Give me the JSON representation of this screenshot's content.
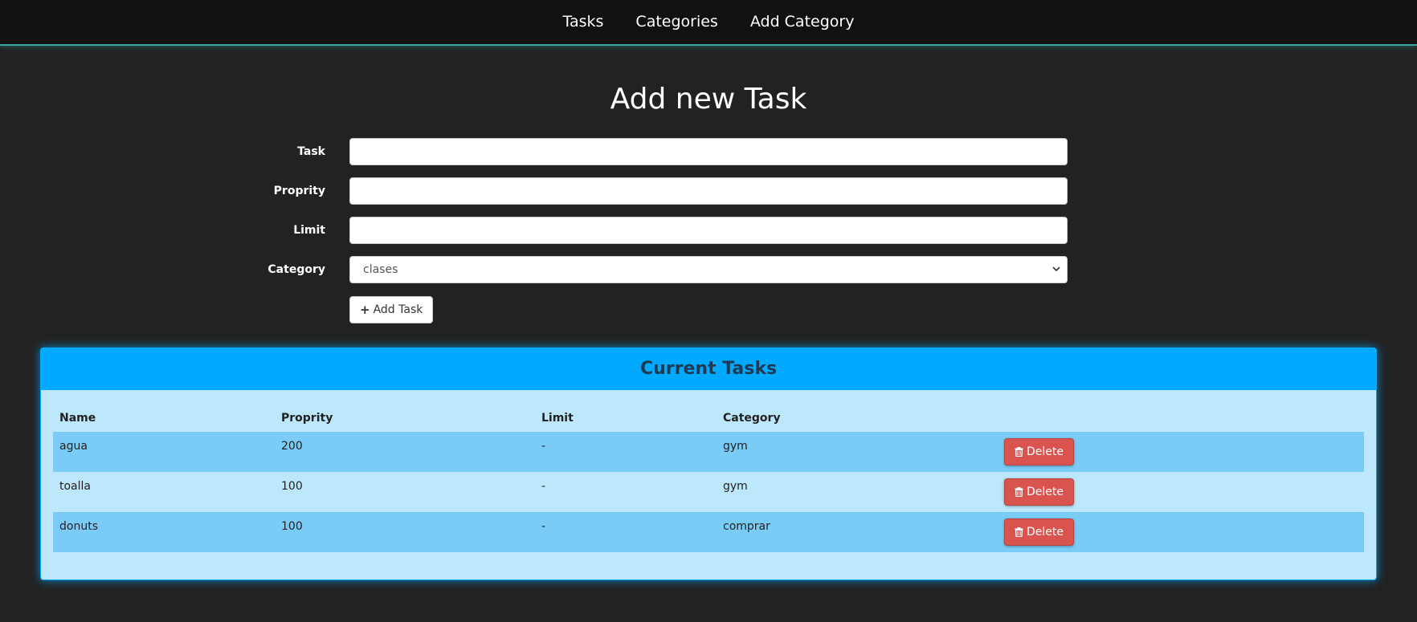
{
  "nav": {
    "items": [
      "Tasks",
      "Categories",
      "Add Category"
    ]
  },
  "page": {
    "title": "Add new Task"
  },
  "form": {
    "task_label": "Task",
    "task_value": "",
    "proprity_label": "Proprity",
    "proprity_value": "",
    "limit_label": "Limit",
    "limit_value": "",
    "category_label": "Category",
    "category_selected": "clases",
    "add_button_label": "Add Task",
    "add_button_icon": "plus-icon"
  },
  "panel": {
    "title": "Current Tasks",
    "columns": [
      "Name",
      "Proprity",
      "Limit",
      "Category"
    ],
    "rows": [
      {
        "name": "agua",
        "proprity": "200",
        "limit": "-",
        "category": "gym",
        "action": "Delete"
      },
      {
        "name": "toalla",
        "proprity": "100",
        "limit": "-",
        "category": "gym",
        "action": "Delete"
      },
      {
        "name": "donuts",
        "proprity": "100",
        "limit": "-",
        "category": "comprar",
        "action": "Delete"
      }
    ],
    "delete_icon": "trash-icon"
  },
  "colors": {
    "background": "#222222",
    "navbar": "#111111",
    "navbar_border": "#3aa6a0",
    "panel_heading": "#02aaff",
    "panel_body": "#bde7fb",
    "row_striped": "#7accf7",
    "delete_button": "#d9534f"
  }
}
